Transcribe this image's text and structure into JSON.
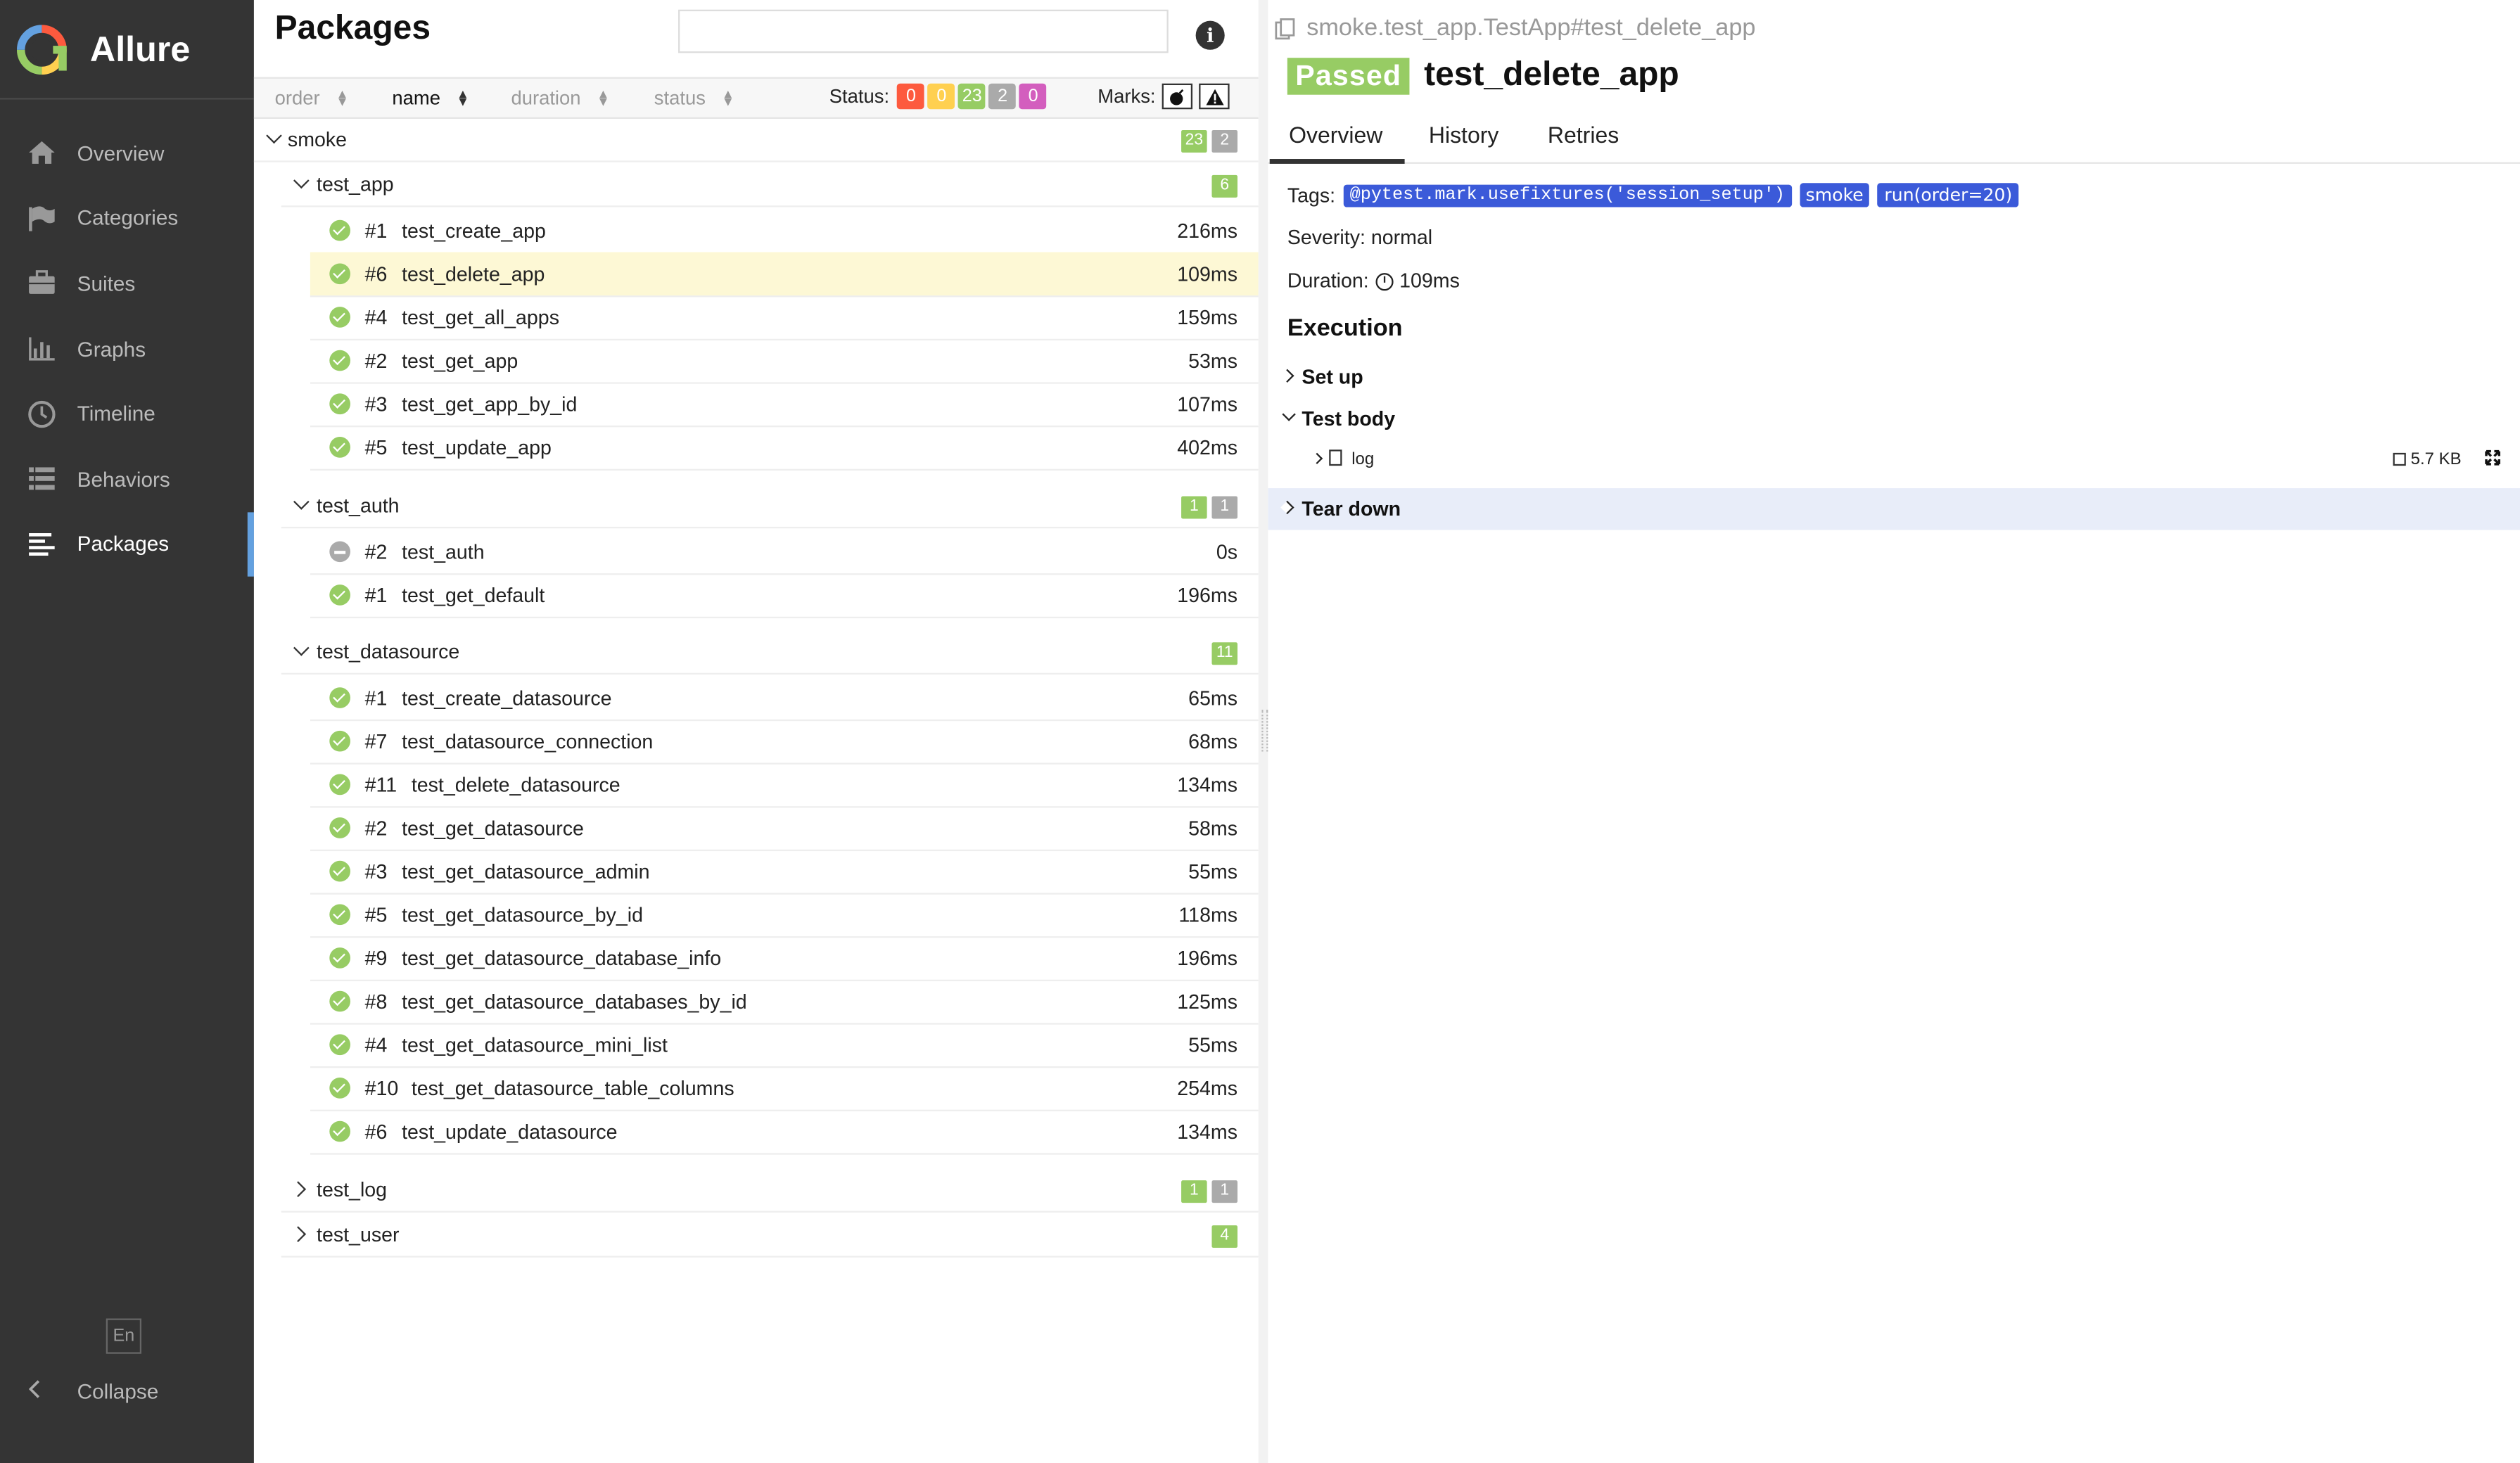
{
  "app": {
    "name": "Allure"
  },
  "sidebar": {
    "items": [
      {
        "label": "Overview",
        "icon": "home-icon"
      },
      {
        "label": "Categories",
        "icon": "flag-icon"
      },
      {
        "label": "Suites",
        "icon": "briefcase-icon"
      },
      {
        "label": "Graphs",
        "icon": "bar-chart-icon"
      },
      {
        "label": "Timeline",
        "icon": "clock-icon"
      },
      {
        "label": "Behaviors",
        "icon": "list-icon"
      },
      {
        "label": "Packages",
        "icon": "align-left-icon",
        "active": true
      }
    ],
    "language": "En",
    "collapse": "Collapse"
  },
  "packages": {
    "title": "Packages",
    "search": {
      "value": "",
      "placeholder": ""
    },
    "sorters": {
      "order": "order",
      "name": "name",
      "duration": "duration",
      "status": "status"
    },
    "status_filter": {
      "label": "Status:",
      "counts": [
        "0",
        "0",
        "23",
        "2",
        "0"
      ]
    },
    "marks": {
      "label": "Marks:"
    },
    "tree": {
      "smoke": {
        "name": "smoke",
        "passed": "23",
        "skipped": "2"
      },
      "test_app": {
        "name": "test_app",
        "passed": "6",
        "tests": [
          {
            "num": "#1",
            "name": "test_create_app",
            "dur": "216ms"
          },
          {
            "num": "#6",
            "name": "test_delete_app",
            "dur": "109ms"
          },
          {
            "num": "#4",
            "name": "test_get_all_apps",
            "dur": "159ms"
          },
          {
            "num": "#2",
            "name": "test_get_app",
            "dur": "53ms"
          },
          {
            "num": "#3",
            "name": "test_get_app_by_id",
            "dur": "107ms"
          },
          {
            "num": "#5",
            "name": "test_update_app",
            "dur": "402ms"
          }
        ]
      },
      "test_auth": {
        "name": "test_auth",
        "passed": "1",
        "skipped": "1",
        "tests": [
          {
            "num": "#2",
            "name": "test_auth",
            "dur": "0s"
          },
          {
            "num": "#1",
            "name": "test_get_default",
            "dur": "196ms"
          }
        ]
      },
      "test_datasource": {
        "name": "test_datasource",
        "passed": "11",
        "tests": [
          {
            "num": "#1",
            "name": "test_create_datasource",
            "dur": "65ms"
          },
          {
            "num": "#7",
            "name": "test_datasource_connection",
            "dur": "68ms"
          },
          {
            "num": "#11",
            "name": "test_delete_datasource",
            "dur": "134ms"
          },
          {
            "num": "#2",
            "name": "test_get_datasource",
            "dur": "58ms"
          },
          {
            "num": "#3",
            "name": "test_get_datasource_admin",
            "dur": "55ms"
          },
          {
            "num": "#5",
            "name": "test_get_datasource_by_id",
            "dur": "118ms"
          },
          {
            "num": "#9",
            "name": "test_get_datasource_database_info",
            "dur": "196ms"
          },
          {
            "num": "#8",
            "name": "test_get_datasource_databases_by_id",
            "dur": "125ms"
          },
          {
            "num": "#4",
            "name": "test_get_datasource_mini_list",
            "dur": "55ms"
          },
          {
            "num": "#10",
            "name": "test_get_datasource_table_columns",
            "dur": "254ms"
          },
          {
            "num": "#6",
            "name": "test_update_datasource",
            "dur": "134ms"
          }
        ]
      },
      "test_log": {
        "name": "test_log",
        "passed": "1",
        "skipped": "1"
      },
      "test_user": {
        "name": "test_user",
        "passed": "4"
      }
    }
  },
  "detail": {
    "breadcrumb": "smoke.test_app.TestApp#test_delete_app",
    "status": "Passed",
    "title": "test_delete_app",
    "tabs": [
      "Overview",
      "History",
      "Retries"
    ],
    "tags_label": "Tags:",
    "tags": [
      "@pytest.mark.usefixtures('session_setup')",
      "smoke",
      "run(order=20)"
    ],
    "severity": "Severity: normal",
    "duration_label": "Duration:",
    "duration": "109ms",
    "execution": "Execution",
    "steps": {
      "setup": "Set up",
      "body": "Test body",
      "teardown": "Tear down"
    },
    "attachment": {
      "name": "log",
      "size": "5.7 KB"
    }
  },
  "colors": {
    "passed": "#97cc64",
    "failed": "#fd5a3e",
    "broken": "#ffd050",
    "skipped": "#aaaaaa",
    "unknown": "#d35ebe",
    "tag": "#3b5ad9",
    "accent": "#64a1e0"
  }
}
